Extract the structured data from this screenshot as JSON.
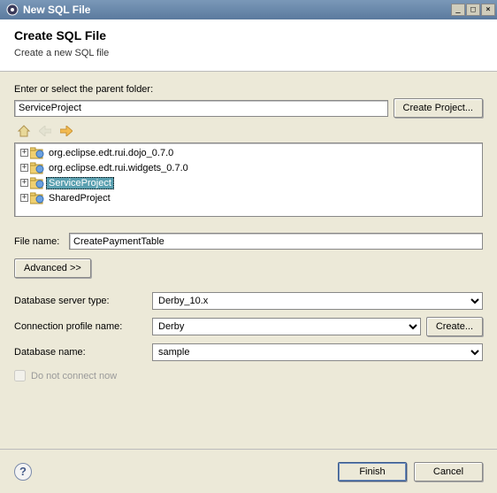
{
  "window": {
    "title": "New SQL File"
  },
  "header": {
    "title": "Create SQL File",
    "subtitle": "Create a new SQL file"
  },
  "parent_folder": {
    "label": "Enter or select the parent folder:",
    "value": "ServiceProject",
    "create_btn": "Create Project..."
  },
  "tree": {
    "items": [
      {
        "label": "org.eclipse.edt.rui.dojo_0.7.0"
      },
      {
        "label": "org.eclipse.edt.rui.widgets_0.7.0"
      },
      {
        "label": "ServiceProject",
        "selected": true
      },
      {
        "label": "SharedProject"
      }
    ]
  },
  "file_name": {
    "label": "File name:",
    "value": "CreatePaymentTable"
  },
  "advanced_btn": "Advanced >>",
  "db_server": {
    "label": "Database server type:",
    "value": "Derby_10.x"
  },
  "conn_profile": {
    "label": "Connection profile name:",
    "value": "Derby",
    "create_btn": "Create..."
  },
  "db_name": {
    "label": "Database name:",
    "value": "sample"
  },
  "do_not_connect": {
    "label": "Do not connect now"
  },
  "buttons": {
    "finish": "Finish",
    "cancel": "Cancel"
  }
}
